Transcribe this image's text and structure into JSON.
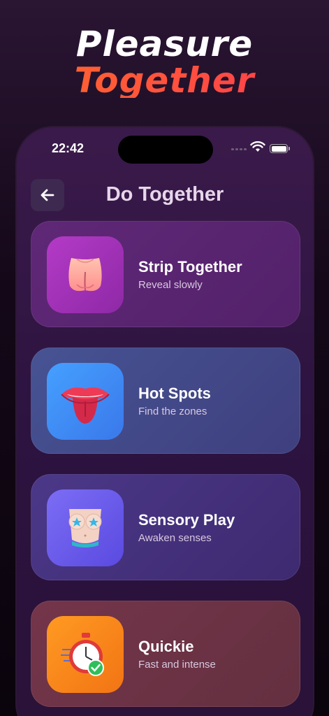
{
  "headline": {
    "line1": "Pleasure",
    "line2": "Together"
  },
  "status_bar": {
    "time": "22:42"
  },
  "nav": {
    "title": "Do Together"
  },
  "cards": [
    {
      "title": "Strip Together",
      "subtitle": "Reveal slowly",
      "icon": "butt-icon",
      "bg": "#5a2570",
      "tile": "#a532b8"
    },
    {
      "title": "Hot Spots",
      "subtitle": "Find the zones",
      "icon": "tongue-lips-icon",
      "bg": "#414a86",
      "tile": "#3e8ff5"
    },
    {
      "title": "Sensory Play",
      "subtitle": "Awaken senses",
      "icon": "body-stars-icon",
      "bg": "#45307a",
      "tile": "#6a5cf0"
    },
    {
      "title": "Quickie",
      "subtitle": "Fast and intense",
      "icon": "stopwatch-icon",
      "bg": "#6a3142",
      "tile": "#f58a1c"
    }
  ]
}
